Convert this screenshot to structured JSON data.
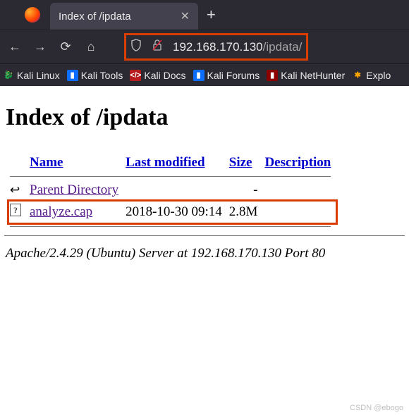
{
  "browser": {
    "tab_title": "Index of /ipdata",
    "url_host": "192.168.170.130",
    "url_path": "/ipdata/"
  },
  "bookmarks": [
    {
      "label": "Kali Linux",
      "icon": "dragon-icon"
    },
    {
      "label": "Kali Tools",
      "icon": "blue-icon"
    },
    {
      "label": "Kali Docs",
      "icon": "red-icon"
    },
    {
      "label": "Kali Forums",
      "icon": "blue-icon"
    },
    {
      "label": "Kali NetHunter",
      "icon": "darkred-icon"
    },
    {
      "label": "Explo",
      "icon": "orange-icon"
    }
  ],
  "page": {
    "title": "Index of /ipdata",
    "columns": {
      "name": "Name",
      "last_modified": "Last modified",
      "size": "Size",
      "description": "Description"
    },
    "parent_label": "Parent Directory",
    "parent_size": "-",
    "files": [
      {
        "name": "analyze.cap",
        "last_modified": "2018-10-30 09:14",
        "size": "2.8M"
      }
    ],
    "server": "Apache/2.4.29 (Ubuntu) Server at 192.168.170.130 Port 80"
  },
  "watermark": "CSDN @ebogo"
}
